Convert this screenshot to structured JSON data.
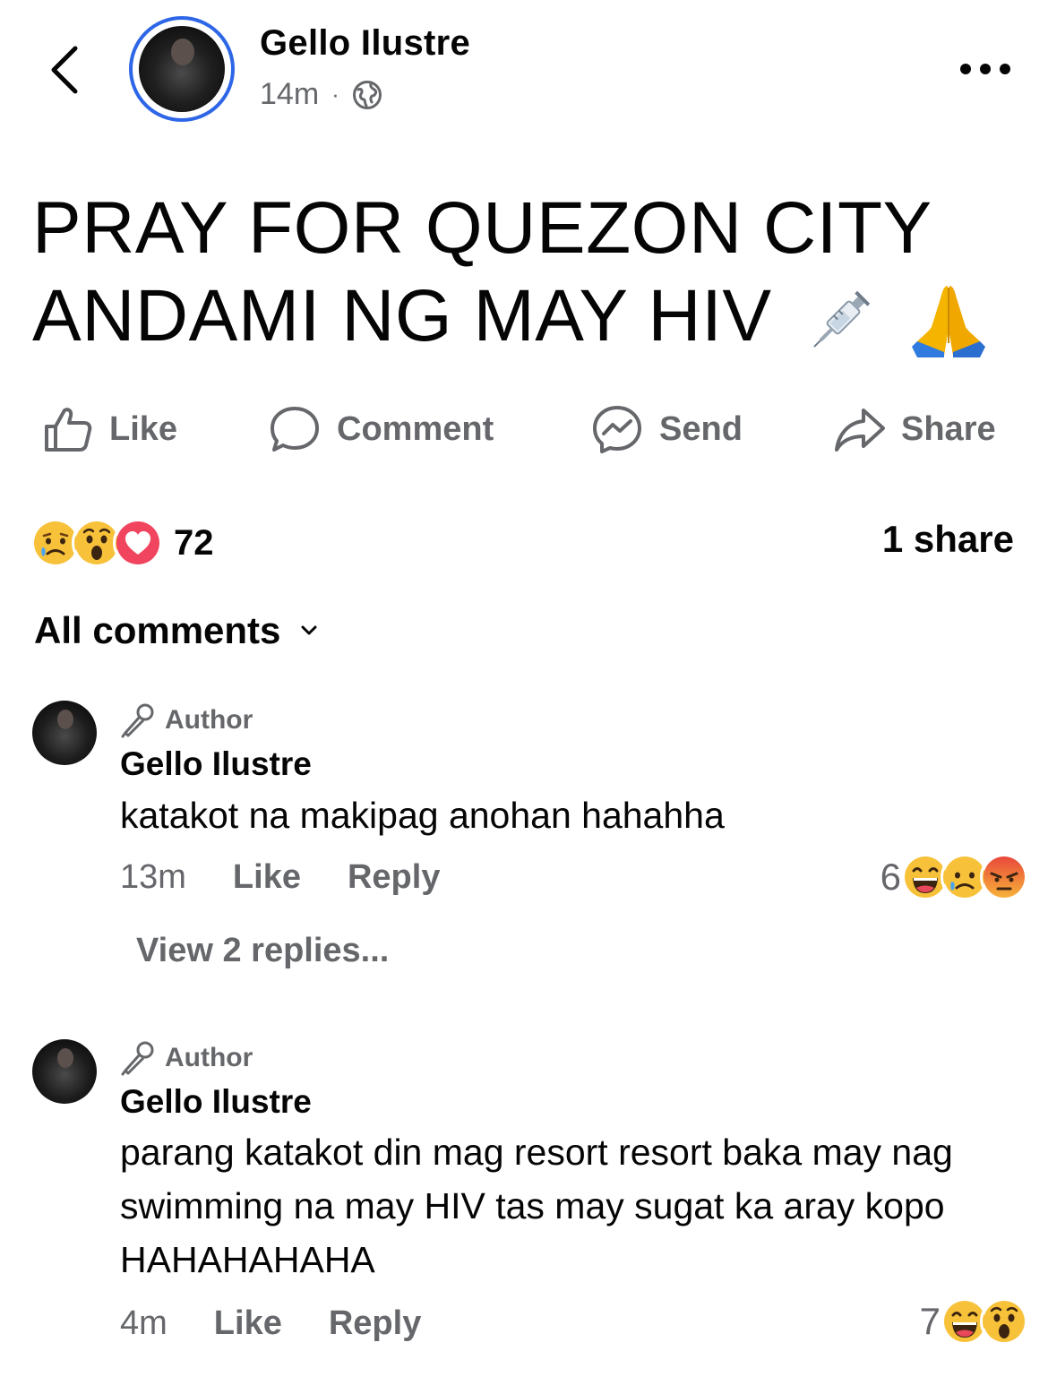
{
  "header": {
    "author_name": "Gello Ilustre",
    "time": "14m",
    "separator": "·",
    "visibility_icon": "globe-icon"
  },
  "post": {
    "line1": "PRAY FOR QUEZON CITY",
    "line2": "ANDAMI NG MAY HIV",
    "emojis": [
      "syringe-icon",
      "praying-hands-icon"
    ]
  },
  "actions": {
    "like": "Like",
    "comment": "Comment",
    "send": "Send",
    "share": "Share"
  },
  "reactions": {
    "icons": [
      "crying-face-icon",
      "surprised-face-icon",
      "love-heart-icon"
    ],
    "count": "72",
    "shares": "1 share"
  },
  "comments_filter": {
    "label": "All comments"
  },
  "comments": [
    {
      "badge": "Author",
      "name": "Gello Ilustre",
      "text": "katakot na makipag anohan hahahha",
      "time": "13m",
      "like": "Like",
      "reply": "Reply",
      "reaction_count": "6",
      "reaction_icons": [
        "laughing-face-icon",
        "crying-face-icon",
        "angry-face-icon"
      ],
      "view_replies": "View 2 replies..."
    },
    {
      "badge": "Author",
      "name": "Gello Ilustre",
      "text": "parang katakot din mag resort resort baka may nag swimming na may HIV tas may sugat ka aray kopo HAHAHAHAHA",
      "time": "4m",
      "like": "Like",
      "reply": "Reply",
      "reaction_count": "7",
      "reaction_icons": [
        "laughing-face-icon",
        "surprised-face-icon"
      ]
    }
  ],
  "colors": {
    "ring_blue": "#2d66e6",
    "muted_text": "#65676b",
    "text": "#050505"
  }
}
